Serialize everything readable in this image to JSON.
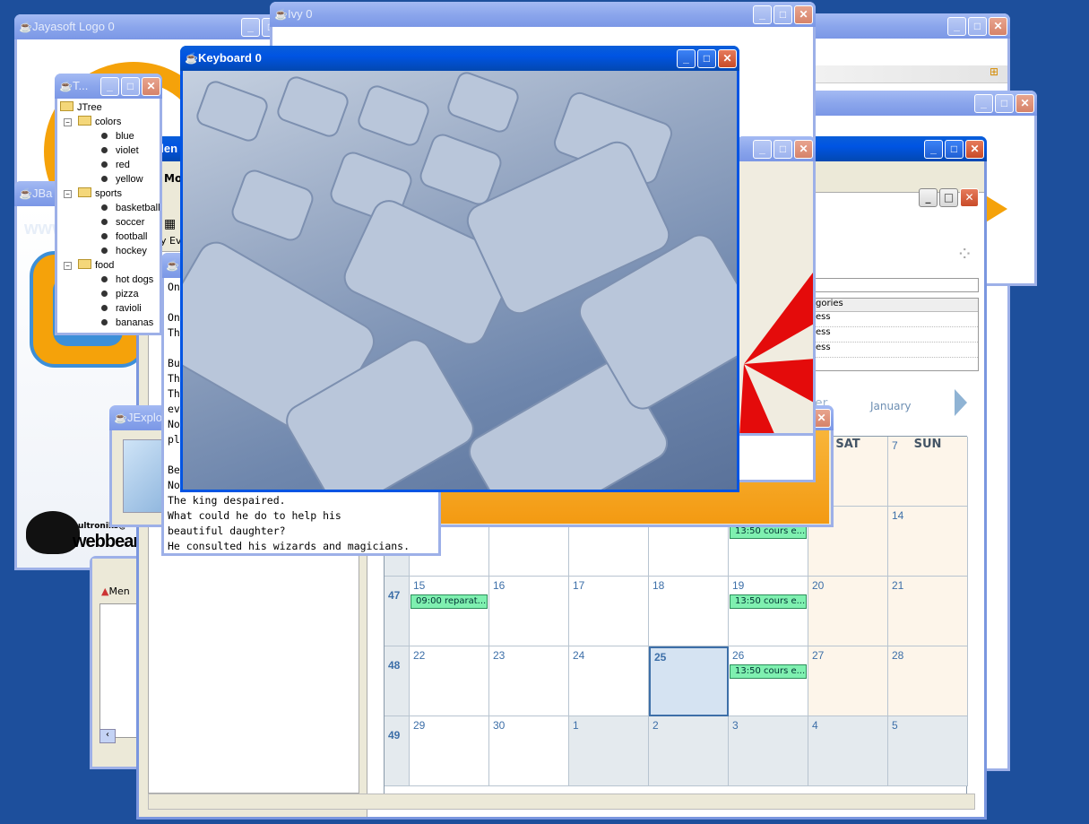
{
  "windows": {
    "jayasoft": {
      "title": "Jayasoft Logo 0"
    },
    "ivy": {
      "title": "Ivy 0"
    },
    "keyboard": {
      "title": "Keyboard 0"
    },
    "jtree": {
      "title": "T..."
    },
    "jbanner": {
      "title": "JBa"
    },
    "jexplorer": {
      "title": "JExplo"
    },
    "calendar": {
      "title": "alen"
    }
  },
  "jtree": {
    "root": "JTree",
    "groups": [
      {
        "label": "colors",
        "items": [
          "blue",
          "violet",
          "red",
          "yellow"
        ]
      },
      {
        "label": "sports",
        "items": [
          "basketball",
          "soccer",
          "football",
          "hockey"
        ]
      },
      {
        "label": "food",
        "items": [
          "hot dogs",
          "pizza",
          "ravioli",
          "bananas"
        ]
      }
    ]
  },
  "story": {
    "lines": [
      "On",
      "",
      "On",
      "Th",
      "",
      "Bu",
      "Th",
      "Th",
      "ev",
      "No",
      "pl",
      "",
      "Be",
      "No",
      "The king despaired.",
      "What could he do to help his",
      "beautiful daughter?",
      "He consulted his wizards and magicians."
    ]
  },
  "mozilla_fragment": {
    "text": "Moz",
    "events": "y Eve"
  },
  "categories": {
    "header": "gories",
    "rows": [
      "ess",
      "ess",
      "ess"
    ]
  },
  "calendar": {
    "month_label": "er",
    "next_month": "January",
    "headers": [
      "SAT",
      "SUN"
    ],
    "weeks": [
      {
        "week": "",
        "days": [
          "",
          "",
          "",
          "",
          "",
          "",
          "7"
        ]
      },
      {
        "week": "",
        "days": [
          "",
          "",
          "",
          "",
          "",
          "",
          "14"
        ]
      },
      {
        "week": "47",
        "days": [
          "15",
          "16",
          "17",
          "18",
          "19",
          "20",
          "21"
        ]
      },
      {
        "week": "48",
        "days": [
          "22",
          "23",
          "24",
          "25",
          "26",
          "27",
          "28"
        ]
      },
      {
        "week": "49",
        "days": [
          "29",
          "30",
          "1",
          "2",
          "3",
          "4",
          "5"
        ]
      }
    ],
    "events": [
      {
        "text": "13:50 cours e...",
        "row": 1,
        "col": 4
      },
      {
        "text": "09:00 reparat...",
        "row": 2,
        "col": 0
      },
      {
        "text": "13:50 cours e...",
        "row": 2,
        "col": 4
      },
      {
        "text": "13:50 cours e...",
        "row": 3,
        "col": 4
      }
    ],
    "today": "25"
  },
  "banner": {
    "www": "www",
    "brand": "webbeans",
    "brand_small": "ultroniks@"
  },
  "menu_fragment": {
    "label": "Men"
  }
}
